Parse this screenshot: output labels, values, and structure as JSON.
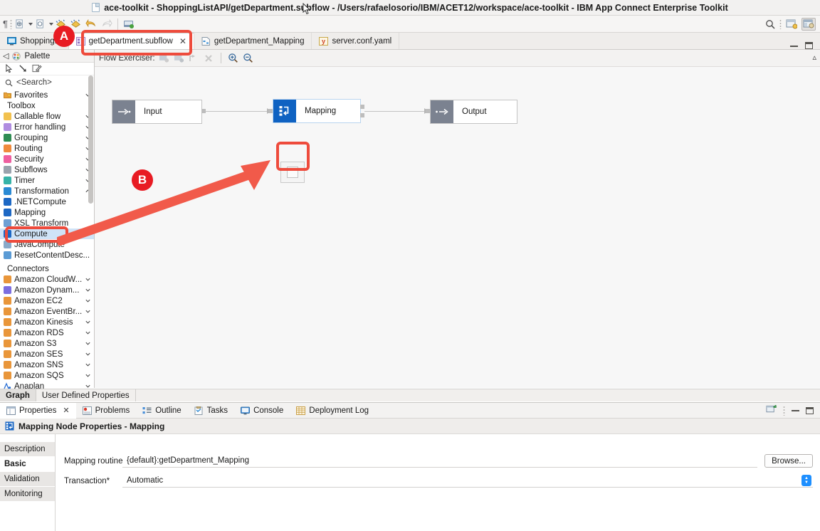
{
  "window": {
    "title": "ace-toolkit - ShoppingListAPI/getDepartment.subflow - /Users/rafaelosorio/IBM/ACET12/workspace/ace-toolkit - IBM App Connect Enterprise Toolkit"
  },
  "editor_tabs": [
    {
      "label": "ShoppingLi",
      "icon": "application-icon",
      "active": false,
      "closable": false
    },
    {
      "label": "getDepartment.subflow",
      "icon": "subflow-icon",
      "active": true,
      "closable": true,
      "close_glyph": "✕"
    },
    {
      "label": "getDepartment_Mapping",
      "icon": "mapping-file-icon",
      "active": false,
      "closable": false
    },
    {
      "label": "server.conf.yaml",
      "icon": "yaml-icon",
      "active": false,
      "closable": false
    }
  ],
  "palette": {
    "header": "Palette",
    "collapse_glyph": "◁",
    "search_placeholder": "<Search>",
    "tools": [
      "select-tool",
      "marquee-tool",
      "note-tool"
    ],
    "favorites": {
      "label": "Favorites",
      "icon_color": "#e9a23b"
    },
    "toolbox_label": "Toolbox",
    "categories": [
      {
        "label": "Callable flow",
        "color": "#f2c14e",
        "expanded": false
      },
      {
        "label": "Error handling",
        "color": "#b08de0",
        "expanded": false
      },
      {
        "label": "Grouping",
        "color": "#2f8c53",
        "expanded": false
      },
      {
        "label": "Routing",
        "color": "#f08a3c",
        "expanded": false
      },
      {
        "label": "Security",
        "color": "#ef5fa0",
        "expanded": false
      },
      {
        "label": "Subflows",
        "color": "#9aa3ad",
        "expanded": false
      },
      {
        "label": "Timer",
        "color": "#36b3a8",
        "expanded": false
      },
      {
        "label": "Transformation",
        "color": "#2a8ad4",
        "expanded": true
      }
    ],
    "transformation_items": [
      {
        "label": ".NETCompute",
        "color": "#1d68c4",
        "selected": false
      },
      {
        "label": "Mapping",
        "color": "#1d68c4",
        "selected": false
      },
      {
        "label": "XSL Transform",
        "color": "#6d9fd4",
        "selected": false
      },
      {
        "label": "Compute",
        "color": "#1d68c4",
        "selected": true
      },
      {
        "label": "JavaCompute",
        "color": "#8aa9c9",
        "selected": false
      },
      {
        "label": "ResetContentDesc...",
        "color": "#5b9bd5",
        "selected": false
      }
    ],
    "connectors_label": "Connectors",
    "connectors": [
      {
        "label": "Amazon CloudW...",
        "color": "#e9963a"
      },
      {
        "label": "Amazon Dynam...",
        "color": "#7c6ee0"
      },
      {
        "label": "Amazon EC2",
        "color": "#e9963a"
      },
      {
        "label": "Amazon EventBr...",
        "color": "#e9963a"
      },
      {
        "label": "Amazon Kinesis",
        "color": "#e9963a"
      },
      {
        "label": "Amazon RDS",
        "color": "#e9963a"
      },
      {
        "label": "Amazon S3",
        "color": "#e9963a"
      },
      {
        "label": "Amazon SES",
        "color": "#e9963a"
      },
      {
        "label": "Amazon SNS",
        "color": "#e9963a"
      },
      {
        "label": "Amazon SQS",
        "color": "#e9963a"
      },
      {
        "label": "Anaplan",
        "color": "#2a6fd4"
      }
    ]
  },
  "editor_toolbar": {
    "flow_exerciser_label": "Flow Exerciser:",
    "zoom_in": "zoom-in-icon",
    "zoom_out": "zoom-out-icon"
  },
  "flow": {
    "nodes": [
      {
        "id": "input",
        "label": "Input",
        "icon": "input-terminal-icon",
        "type": "terminal"
      },
      {
        "id": "mapping",
        "label": "Mapping",
        "icon": "mapping-node-icon",
        "type": "mapping"
      },
      {
        "id": "output",
        "label": "Output",
        "icon": "output-terminal-icon",
        "type": "terminal"
      }
    ],
    "dropped_node": {
      "id": "compute-drop-target",
      "label": ""
    }
  },
  "graph_tabs": [
    {
      "label": "Graph",
      "active": true
    },
    {
      "label": "User Defined Properties",
      "active": false
    }
  ],
  "properties_view": {
    "tabs": [
      {
        "label": "Properties",
        "icon": "properties-icon",
        "active": true,
        "closable": true,
        "close_glyph": "✕"
      },
      {
        "label": "Problems",
        "icon": "problems-icon",
        "active": false,
        "closable": false
      },
      {
        "label": "Outline",
        "icon": "outline-icon",
        "active": false,
        "closable": false
      },
      {
        "label": "Tasks",
        "icon": "tasks-icon",
        "active": false,
        "closable": false
      },
      {
        "label": "Console",
        "icon": "console-icon",
        "active": false,
        "closable": false
      },
      {
        "label": "Deployment Log",
        "icon": "deployment-log-icon",
        "active": false,
        "closable": false
      }
    ],
    "title": "Mapping Node Properties - Mapping",
    "title_icon": "mapping-node-icon",
    "side_tabs": [
      {
        "label": "Description",
        "active": false
      },
      {
        "label": "Basic",
        "active": true
      },
      {
        "label": "Validation",
        "active": false
      },
      {
        "label": "Monitoring",
        "active": false
      }
    ],
    "fields": [
      {
        "name": "mapping-routine",
        "label": "Mapping routine*",
        "value": "{default}:getDepartment_Mapping",
        "control": "text",
        "button": "Browse..."
      },
      {
        "name": "transaction",
        "label": "Transaction*",
        "value": "Automatic",
        "control": "combo"
      }
    ]
  },
  "annotations": [
    {
      "id": "A",
      "label": "A"
    },
    {
      "id": "B",
      "label": "B"
    }
  ],
  "colors": {
    "annotation_red": "#e81b23",
    "annotation_arrow": "#f15a4a",
    "accent_blue": "#0f62c2",
    "selection_blue": "#cfe3f7"
  }
}
